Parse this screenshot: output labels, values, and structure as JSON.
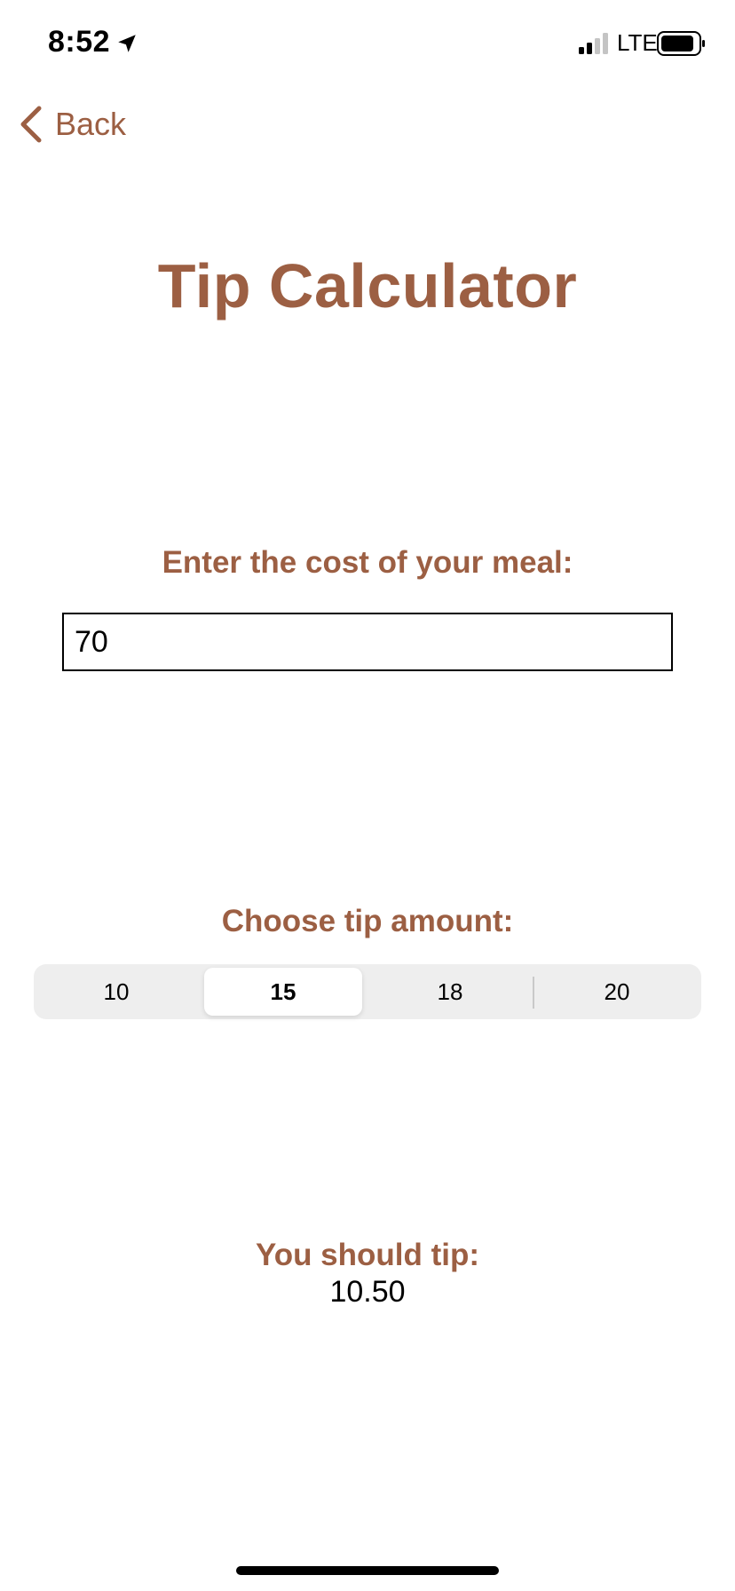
{
  "status_bar": {
    "time": "8:52",
    "network": "LTE",
    "icons": [
      "location-arrow-icon",
      "signal-icon",
      "battery-icon"
    ]
  },
  "nav": {
    "back_label": "Back"
  },
  "title": "Tip Calculator",
  "cost": {
    "label": "Enter the cost of your meal:",
    "value": "70",
    "placeholder": ""
  },
  "tip": {
    "label": "Choose tip amount:",
    "options": [
      "10",
      "15",
      "18",
      "20"
    ],
    "selected": "15"
  },
  "result": {
    "label": "You should tip:",
    "value": "10.50"
  },
  "colors": {
    "accent": "#9c5f43",
    "segment_bg": "#eeeeee",
    "segment_selected": "#ffffff"
  }
}
